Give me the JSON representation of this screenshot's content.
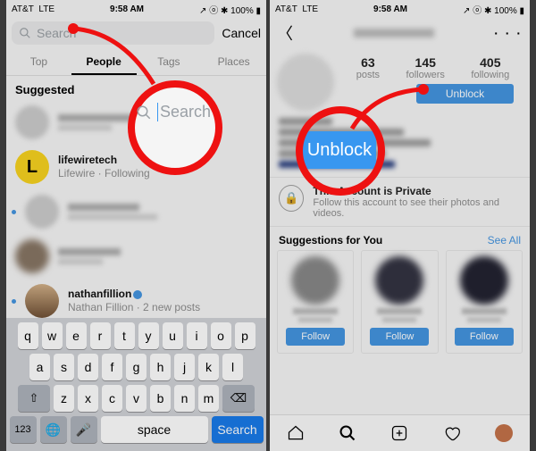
{
  "status": {
    "carrier": "AT&T",
    "net": "LTE",
    "time": "9:58 AM",
    "batt": "100%"
  },
  "left": {
    "search_placeholder": "Search",
    "cancel": "Cancel",
    "tabs": {
      "top": "Top",
      "people": "People",
      "tags": "Tags",
      "places": "Places"
    },
    "suggested": "Suggested",
    "rows": {
      "lifewire": {
        "name": "lifewiretech",
        "sub": "Lifewire · Following"
      },
      "nathan": {
        "name": "nathanfillion",
        "sub": "Nathan Fillion · 2 new posts"
      }
    },
    "keyboard": {
      "r1": [
        "q",
        "w",
        "e",
        "r",
        "t",
        "y",
        "u",
        "i",
        "o",
        "p"
      ],
      "r2": [
        "a",
        "s",
        "d",
        "f",
        "g",
        "h",
        "j",
        "k",
        "l"
      ],
      "r3": [
        "z",
        "x",
        "c",
        "v",
        "b",
        "n",
        "m"
      ],
      "shift": "⇧",
      "back": "⌫",
      "num": "123",
      "globe": "🌐",
      "mic": "🎤",
      "space": "space",
      "search": "Search"
    },
    "callout": {
      "label": "Search"
    }
  },
  "right": {
    "stats": {
      "posts_n": "63",
      "posts_l": "posts",
      "followers_n": "145",
      "followers_l": "followers",
      "following_n": "405",
      "following_l": "following"
    },
    "unblock": "Unblock",
    "private": {
      "title": "This Account is Private",
      "sub": "Follow this account to see their photos and videos."
    },
    "sugg": {
      "title": "Suggestions for You",
      "see_all": "See All"
    },
    "follow": "Follow",
    "menu": "· · ·"
  },
  "callout_unblock": "Unblock"
}
